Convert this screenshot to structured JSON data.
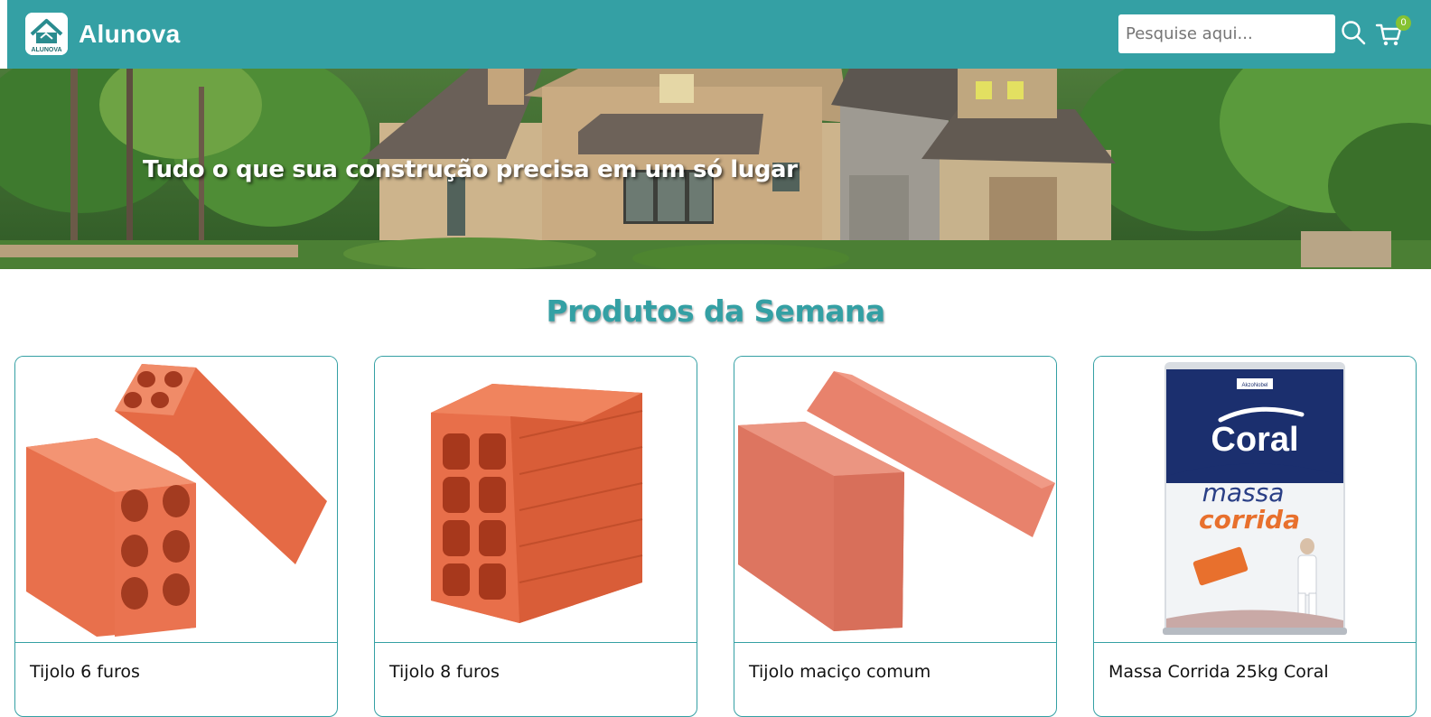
{
  "header": {
    "brand": "Alunova",
    "logo_text": "ALUNOVA",
    "search_placeholder": "Pesquise aqui...",
    "cart_count": "0",
    "colors": {
      "primary": "#34a0a4",
      "badge": "#86c232"
    }
  },
  "hero": {
    "headline": "Tudo o que sua construção precisa em um só lugar"
  },
  "section": {
    "title": "Produtos da Semana"
  },
  "products": [
    {
      "name": "Tijolo 6 furos",
      "image": "tijolo-6-furos"
    },
    {
      "name": "Tijolo 8 furos",
      "image": "tijolo-8-furos"
    },
    {
      "name": "Tijolo maciço comum",
      "image": "tijolo-macico"
    },
    {
      "name": "Massa Corrida 25kg Coral",
      "image": "massa-corrida-coral"
    }
  ],
  "paint_can": {
    "maker": "AkzoNobel",
    "brand": "Coral",
    "line1": "massa",
    "line2": "corrida"
  }
}
